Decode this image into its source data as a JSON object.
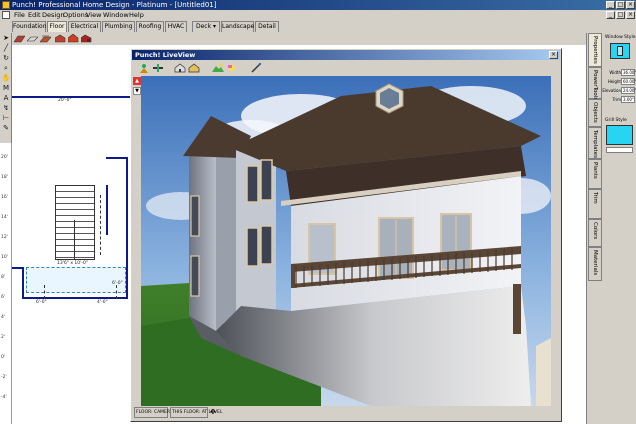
{
  "window": {
    "title": "Punch! Professional Home Design - Platinum - [Untitled01]",
    "controls": [
      "_",
      "□",
      "×"
    ]
  },
  "menu": {
    "items": [
      "File",
      "Edit",
      "Design",
      "Options",
      "View",
      "Window",
      "Help"
    ]
  },
  "tabs": [
    "Foundation",
    "Floor",
    "Electrical",
    "Plumbing",
    "Roofing",
    "HVAC",
    "Deck ▾",
    "Landscape",
    "Detail"
  ],
  "active_tab": "Floor",
  "plan": {
    "ruler_labels": [
      "20'",
      "18'",
      "16'",
      "14'",
      "12'",
      "10'",
      "8'",
      "6'",
      "4'",
      "2'",
      "0'",
      "-2'",
      "-4'"
    ],
    "top_dimension": "20'-0\"",
    "room_dim_1": "13'6\" x 10'-0\"",
    "room_dim_2": "6'-0\"",
    "room_dim_3": "4'-0\"",
    "room_dim_4": "6'-0\""
  },
  "liveview": {
    "title": "Punch! LiveView",
    "close": "×",
    "status_1": "FLOOR: CAMERA",
    "status_2": "THIS FLOOR: AT LEVEL"
  },
  "right_tabs": [
    "Properties",
    "PowerTools",
    "Objects",
    "Templates",
    "Plants",
    "Trim",
    "Colors",
    "Materials"
  ],
  "properties": {
    "window_style_label": "Window Style",
    "fields": [
      {
        "label": "Width",
        "value": "36.00\""
      },
      {
        "label": "Height",
        "value": "60.00\""
      },
      {
        "label": "Elevation",
        "value": "24.00\""
      },
      {
        "label": "Trim",
        "value": "3.00\""
      }
    ],
    "grill_style_label": "Grill Style"
  },
  "colors": {
    "titlebar": "#0a246a",
    "wall": "#0c1a8a",
    "grill": "#27d4f2"
  }
}
